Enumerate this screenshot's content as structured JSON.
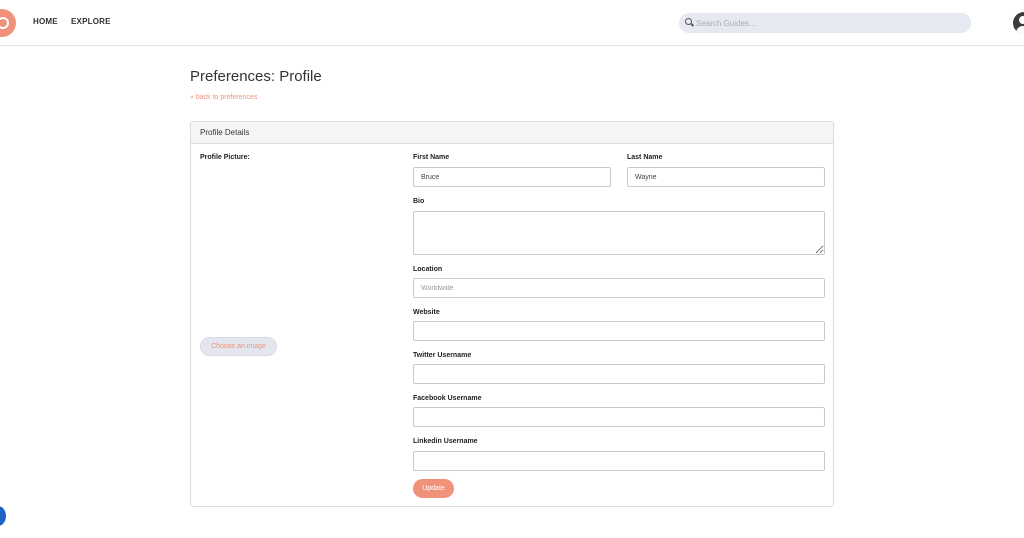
{
  "nav": {
    "home_label": "HOME",
    "explore_label": "EXPLORE",
    "search_placeholder": "Search Guides..."
  },
  "page": {
    "title": "Preferences: Profile",
    "back_link": "« back to preferences"
  },
  "panel": {
    "heading": "Profile Details",
    "profile_picture_label": "Profile Picture:",
    "choose_image_label": "Choose an image",
    "update_label": "Update"
  },
  "form": {
    "first_name": {
      "label": "First Name",
      "value": "Bruce"
    },
    "last_name": {
      "label": "Last Name",
      "value": "Wayne"
    },
    "bio": {
      "label": "Bio",
      "value": ""
    },
    "location": {
      "label": "Location",
      "value": "",
      "placeholder": "Worldwide"
    },
    "website": {
      "label": "Website",
      "value": ""
    },
    "twitter": {
      "label": "Twitter Username",
      "value": ""
    },
    "facebook": {
      "label": "Facebook Username",
      "value": ""
    },
    "linkedin": {
      "label": "Linkedin Username",
      "value": ""
    }
  },
  "colors": {
    "accent": "#f0927a",
    "search_bg": "#e6e9f1",
    "help_bubble": "#1e63c4"
  }
}
